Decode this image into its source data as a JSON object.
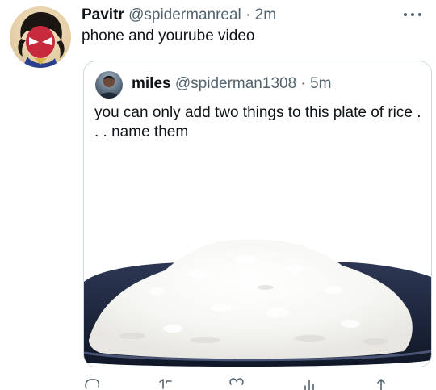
{
  "tweet": {
    "author_name": "Pavitr",
    "author_handle": "@spidermanreal",
    "separator": "·",
    "time": "2m",
    "text": "phone and yourube video"
  },
  "quote": {
    "author_name": "miles",
    "author_handle": "@spiderman1308",
    "separator": "·",
    "time": "5m",
    "text": "you can only add two things to this plate of rice . . . name them",
    "media_alt": "plate of white rice"
  },
  "icons": {
    "more": "more-horizontal-icon",
    "reply": "reply-icon",
    "retweet": "retweet-icon",
    "like": "heart-icon",
    "analytics": "analytics-icon",
    "share": "share-icon"
  }
}
